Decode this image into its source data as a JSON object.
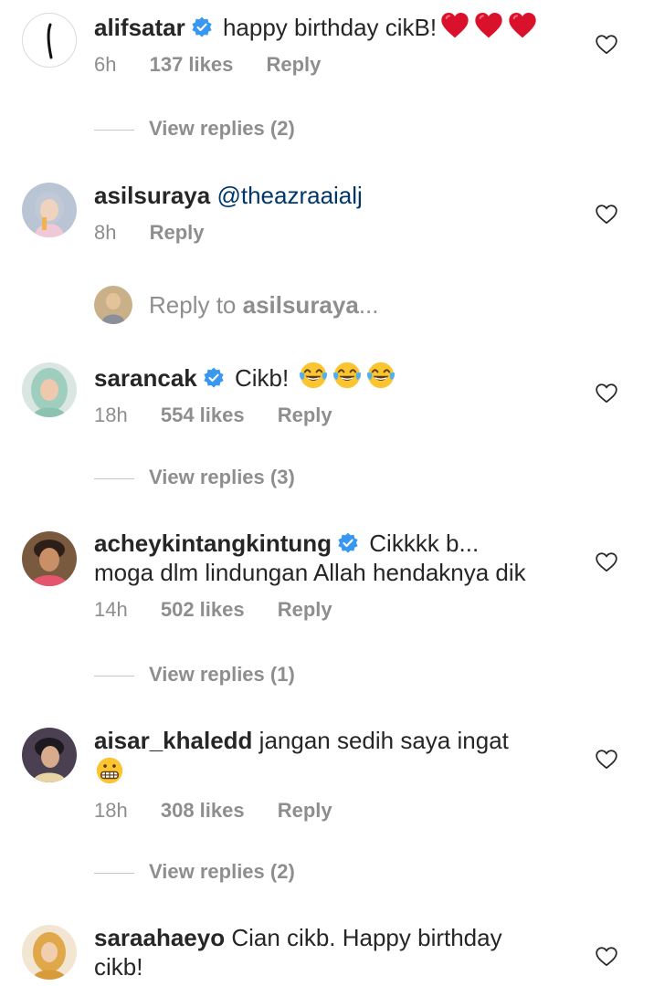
{
  "comments": [
    {
      "username": "alifsatar",
      "verified": true,
      "text": "happy birthday cikB!",
      "emoji": "heart-emoji x3",
      "time": "6h",
      "likes": "137 likes",
      "reply": "Reply",
      "view_replies": "View replies (2)"
    },
    {
      "username": "asilsuraya",
      "verified": false,
      "text": "@theazraaialj",
      "time": "8h",
      "reply": "Reply",
      "reply_prompt_prefix": "Reply to ",
      "reply_prompt_user": "asilsuraya",
      "reply_prompt_suffix": "..."
    },
    {
      "username": "sarancak",
      "verified": true,
      "text": "Cikb!",
      "emoji": "tears-of-joy-emoji x3",
      "time": "18h",
      "likes": "554 likes",
      "reply": "Reply",
      "view_replies": "View replies (3)"
    },
    {
      "username": "acheykintangkintung",
      "verified": true,
      "text_line1": "Cikkkk b...",
      "text_line2": "moga dlm lindungan Allah hendaknya dik",
      "time": "14h",
      "likes": "502 likes",
      "reply": "Reply",
      "view_replies": "View replies (1)"
    },
    {
      "username": "aisar_khaledd",
      "verified": false,
      "text": "jangan sedih saya ingat",
      "emoji": "grimacing-emoji",
      "time": "18h",
      "likes": "308 likes",
      "reply": "Reply",
      "view_replies": "View replies (2)"
    },
    {
      "username": "saraahaeyo",
      "verified": false,
      "text_line1": "Cian cikb. Happy birthday",
      "text_line2": "cikb!"
    }
  ],
  "icons": {
    "like": "heart-outline-icon",
    "verified": "verified-badge-icon"
  },
  "colors": {
    "text": "#262626",
    "secondary": "#8e8e8e",
    "verified": "#3897f0",
    "mention": "#00376b",
    "heart_emoji": "#e0142b"
  }
}
